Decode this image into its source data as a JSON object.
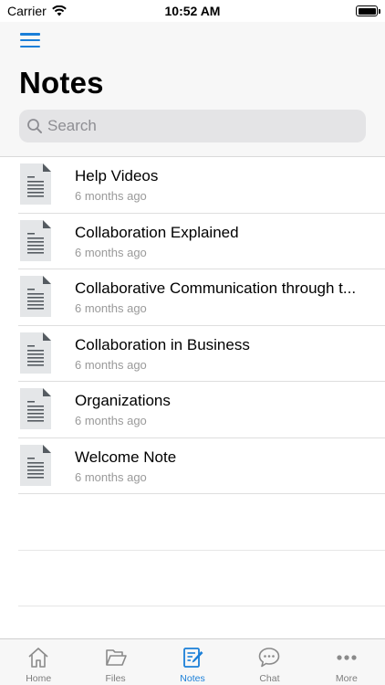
{
  "status_bar": {
    "carrier": "Carrier",
    "time": "10:52 AM"
  },
  "header": {
    "title": "Notes",
    "menu_icon": "hamburger-menu-icon"
  },
  "search": {
    "placeholder": "Search",
    "value": ""
  },
  "notes": [
    {
      "title": "Help Videos",
      "subtitle": "6 months ago"
    },
    {
      "title": "Collaboration Explained",
      "subtitle": "6 months ago"
    },
    {
      "title": "Collaborative Communication through t...",
      "subtitle": "6 months ago"
    },
    {
      "title": "Collaboration in Business",
      "subtitle": "6 months ago"
    },
    {
      "title": "Organizations",
      "subtitle": "6 months ago"
    },
    {
      "title": "Welcome Note",
      "subtitle": "6 months ago"
    }
  ],
  "tabs": [
    {
      "label": "Home",
      "icon": "home-icon"
    },
    {
      "label": "Files",
      "icon": "folder-icon"
    },
    {
      "label": "Notes",
      "icon": "notes-icon",
      "active": true
    },
    {
      "label": "Chat",
      "icon": "chat-icon"
    },
    {
      "label": "More",
      "icon": "more-dots-icon"
    }
  ],
  "colors": {
    "accent": "#1a7fd8",
    "inactive": "#7d7d7d",
    "subtitle": "#9a9a9a",
    "doc_icon": "#e4e6e8"
  }
}
